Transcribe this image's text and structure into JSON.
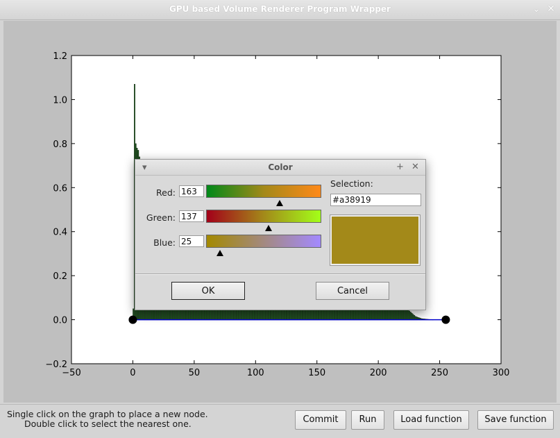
{
  "window": {
    "title": "GPU based Volume Renderer Program Wrapper"
  },
  "chart_data": {
    "type": "bar",
    "xlim": [
      -50,
      300
    ],
    "ylim": [
      -0.2,
      1.2
    ],
    "x_ticks": [
      "−50",
      "0",
      "50",
      "100",
      "150",
      "200",
      "250",
      "300"
    ],
    "y_ticks": [
      "−0.2",
      "0.0",
      "0.2",
      "0.4",
      "0.6",
      "0.8",
      "1.0",
      "1.2"
    ],
    "histogram": {
      "x": [
        0,
        1,
        2,
        3,
        4,
        5,
        6,
        7,
        8,
        10,
        15,
        20,
        25,
        30,
        40,
        50,
        60,
        70,
        80,
        90,
        100,
        110,
        120,
        130,
        140,
        150,
        160,
        170,
        180,
        190,
        200,
        205,
        210,
        215,
        220,
        225,
        230,
        235,
        240,
        245,
        250
      ],
      "values": [
        0.05,
        1.07,
        0.8,
        0.78,
        0.77,
        0.74,
        0.7,
        0.6,
        0.45,
        0.25,
        0.12,
        0.09,
        0.08,
        0.07,
        0.065,
        0.06,
        0.05,
        0.045,
        0.045,
        0.05,
        0.055,
        0.06,
        0.06,
        0.06,
        0.06,
        0.055,
        0.05,
        0.05,
        0.055,
        0.06,
        0.07,
        0.075,
        0.08,
        0.075,
        0.06,
        0.04,
        0.015,
        0.005,
        0.002,
        0.0,
        0.0
      ]
    },
    "transfer_function": {
      "x": [
        0,
        255
      ],
      "y": [
        0.0,
        0.0
      ]
    }
  },
  "status": {
    "hint_line1": "Single click on the graph to place a new node.",
    "hint_line2": "Double click to select the nearest one."
  },
  "buttons": {
    "commit": "Commit",
    "run": "Run",
    "load": "Load function",
    "save": "Save function"
  },
  "color_dialog": {
    "title": "Color",
    "red_label": "Red:",
    "green_label": "Green:",
    "blue_label": "Blue:",
    "red_value": "163",
    "green_value": "137",
    "blue_value": "25",
    "selection_label": "Selection:",
    "selection_value": "#a38919",
    "selected_color": "#a38919",
    "ok_label": "OK",
    "cancel_label": "Cancel"
  }
}
